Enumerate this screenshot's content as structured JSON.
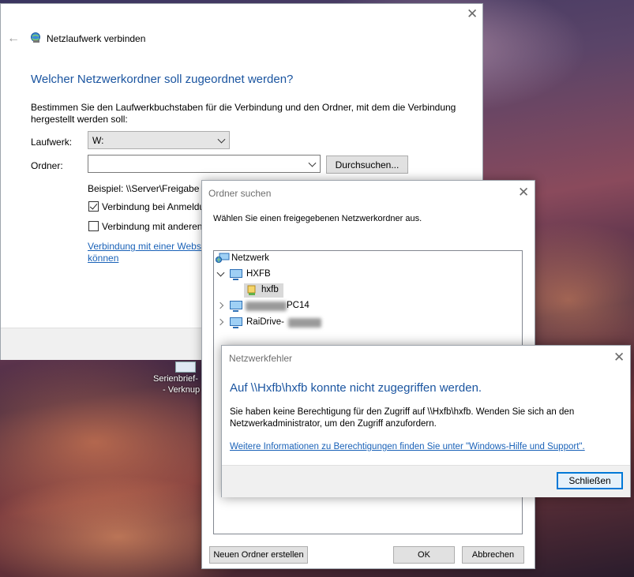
{
  "main_dialog": {
    "title": "Netzlaufwerk verbinden",
    "heading": "Welcher Netzwerkordner soll zugeordnet werden?",
    "description": "Bestimmen Sie den Laufwerkbuchstaben für die Verbindung und den Ordner, mit dem die Verbindung hergestellt werden soll:",
    "drive_label": "Laufwerk:",
    "drive_value": "W:",
    "folder_label": "Ordner:",
    "folder_value": "",
    "browse_button": "Durchsuchen...",
    "example": "Beispiel: \\\\Server\\Freigabe",
    "reconnect_label": "Verbindung bei Anmeldu",
    "reconnect_checked": true,
    "other_credentials_label": "Verbindung mit anderen",
    "other_credentials_checked": false,
    "website_link_line1": "Verbindung mit einer Websi",
    "website_link_line2": "können"
  },
  "browse_dialog": {
    "title": "Ordner suchen",
    "instruction": "Wählen Sie einen freigegebenen Netzwerkordner aus.",
    "tree": {
      "root": "Netzwerk",
      "items": [
        {
          "label": "HXFB",
          "expanded": true
        },
        {
          "label": "hxfb",
          "child": true,
          "selected": true
        },
        {
          "label": "PC14",
          "blurred_prefix": true
        },
        {
          "label": "RaiDrive-",
          "blurred_suffix": true
        }
      ]
    },
    "new_folder_button": "Neuen Ordner erstellen",
    "ok_button": "OK",
    "cancel_button": "Abbrechen"
  },
  "error_dialog": {
    "title": "Netzwerkfehler",
    "heading": "Auf \\\\Hxfb\\hxfb konnte nicht zugegriffen werden.",
    "message": "Sie haben keine Berechtigung für den Zugriff auf \\\\Hxfb\\hxfb. Wenden Sie sich an den Netzwerkadministrator, um den Zugriff anzufordern.",
    "help_link": "Weitere Informationen zu Berechtigungen finden Sie unter \"Windows-Hilfe und Support\".",
    "close_button": "Schließen"
  },
  "desktop": {
    "shortcut_line1": "Serienbrief-",
    "shortcut_line2": "- Verknup"
  },
  "colors": {
    "heading_blue": "#1b55a0",
    "link_blue": "#1a62b8",
    "default_button_border": "#0078d7"
  }
}
